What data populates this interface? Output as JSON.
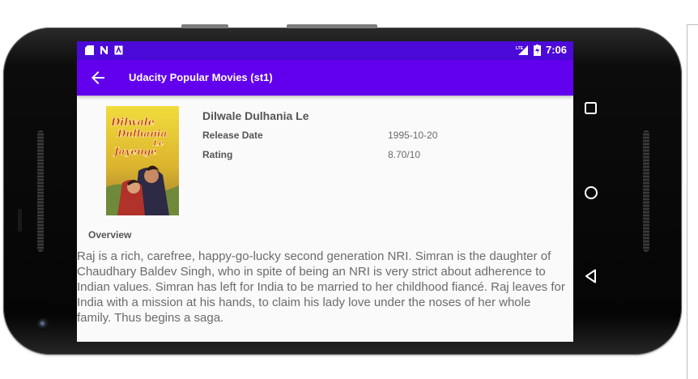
{
  "status_bar": {
    "time": "7:06",
    "network_label": "LTE",
    "icons": [
      "sd-card-icon",
      "no-sim-icon",
      "keyboard-icon"
    ]
  },
  "app_bar": {
    "title": "Udacity Popular Movies (st1)",
    "back_icon": "arrow-left-icon"
  },
  "movie": {
    "title": "Dilwale Dulhania Le",
    "poster_title_lines": [
      "Dilwale",
      "Dulhania",
      "Le",
      "Jayenge"
    ],
    "release_date_label": "Release Date",
    "release_date": "1995-10-20",
    "rating_label": "Rating",
    "rating": "8.70/10",
    "overview_label": "Overview",
    "overview": "Raj is a rich, carefree, happy-go-lucky second generation NRI. Simran is the daughter of Chaudhary Baldev Singh, who in spite of being an NRI is very strict about adherence to Indian values. Simran has left for India to be married to her childhood fiancé. Raj leaves for India with a mission at his hands, to claim his lady love under the noses of her whole family. Thus begins a saga."
  },
  "navigation": {
    "buttons": [
      "recents-square-icon",
      "home-circle-icon",
      "back-triangle-icon"
    ]
  },
  "colors": {
    "status_bar": "#4c0ad9",
    "app_bar": "#6200ee",
    "screen_background": "#fafafa",
    "device_body": "#0c0c0c"
  }
}
